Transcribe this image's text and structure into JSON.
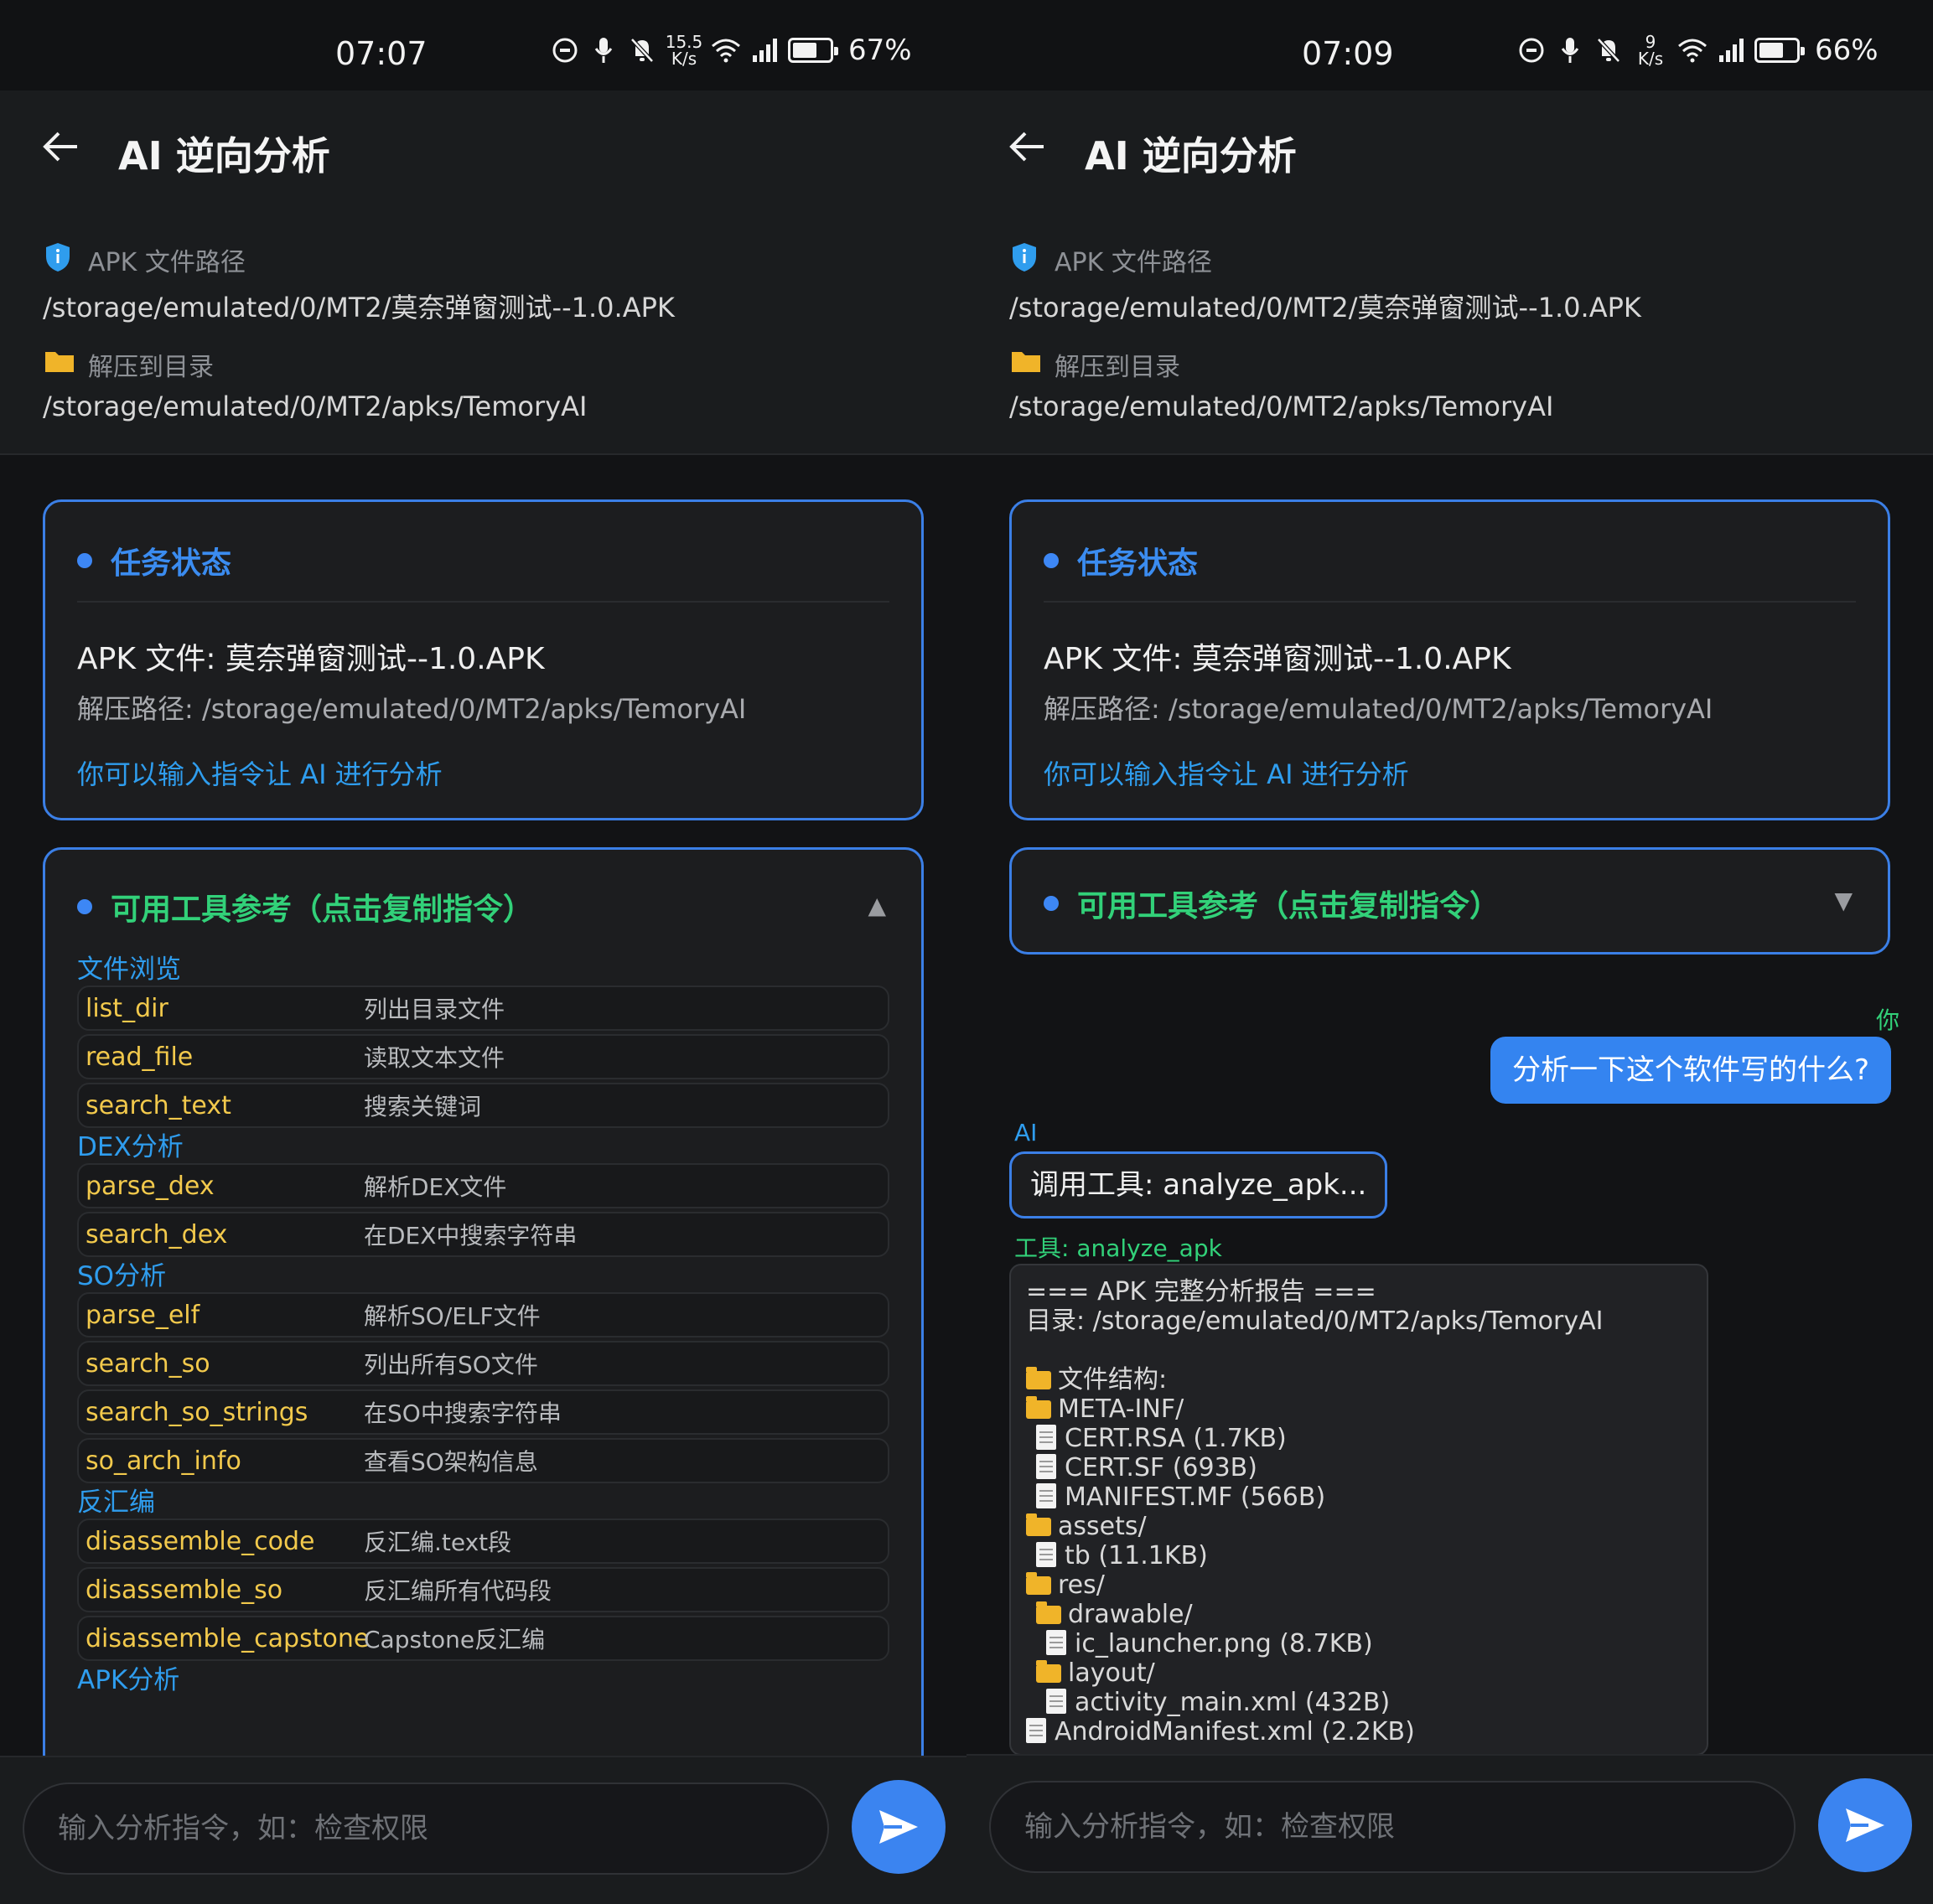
{
  "screens": [
    {
      "status": {
        "time": "07:07",
        "speed_top": "15.5",
        "speed_bottom": "K/s",
        "battery_pct": 0.67,
        "battery_text": "67%"
      },
      "header": {
        "title": "AI 逆向分析",
        "apk_label": "APK 文件路径",
        "apk_path": "/storage/emulated/0/MT2/莫奈弹窗测试--1.0.APK",
        "dir_label": "解压到目录",
        "dir_path": "/storage/emulated/0/MT2/apks/TemoryAI"
      },
      "task": {
        "title": "任务状态",
        "apk_file": "APK 文件: 莫奈弹窗测试--1.0.APK",
        "extract_path": "解压路径: /storage/emulated/0/MT2/apks/TemoryAI",
        "hint": "你可以输入指令让 AI 进行分析"
      },
      "tools": {
        "title": "可用工具参考（点击复制指令）",
        "caret": "▲"
      },
      "input": {
        "placeholder": "输入分析指令，如：检查权限"
      }
    },
    {
      "status": {
        "time": "07:09",
        "speed_top": "9",
        "speed_bottom": "K/s",
        "battery_pct": 0.66,
        "battery_text": "66%"
      },
      "header": {
        "title": "AI 逆向分析",
        "apk_label": "APK 文件路径",
        "apk_path": "/storage/emulated/0/MT2/莫奈弹窗测试--1.0.APK",
        "dir_label": "解压到目录",
        "dir_path": "/storage/emulated/0/MT2/apks/TemoryAI"
      },
      "task": {
        "title": "任务状态",
        "apk_file": "APK 文件: 莫奈弹窗测试--1.0.APK",
        "extract_path": "解压路径: /storage/emulated/0/MT2/apks/TemoryAI",
        "hint": "你可以输入指令让 AI 进行分析"
      },
      "tools": {
        "title": "可用工具参考（点击复制指令）",
        "caret": "▼"
      },
      "input": {
        "placeholder": "输入分析指令，如：检查权限"
      }
    }
  ],
  "tool_categories": [
    {
      "label": "文件浏览",
      "items": [
        {
          "name": "list_dir",
          "desc": "列出目录文件"
        },
        {
          "name": "read_file",
          "desc": "读取文本文件"
        },
        {
          "name": "search_text",
          "desc": "搜索关键词"
        }
      ]
    },
    {
      "label": "DEX分析",
      "items": [
        {
          "name": "parse_dex",
          "desc": "解析DEX文件"
        },
        {
          "name": "search_dex",
          "desc": "在DEX中搜索字符串"
        }
      ]
    },
    {
      "label": "SO分析",
      "items": [
        {
          "name": "parse_elf",
          "desc": "解析SO/ELF文件"
        },
        {
          "name": "search_so",
          "desc": "列出所有SO文件"
        },
        {
          "name": "search_so_strings",
          "desc": "在SO中搜索字符串"
        },
        {
          "name": "so_arch_info",
          "desc": "查看SO架构信息"
        }
      ]
    },
    {
      "label": "反汇编",
      "items": [
        {
          "name": "disassemble_code",
          "desc": "反汇编.text段"
        },
        {
          "name": "disassemble_so",
          "desc": "反汇编所有代码段"
        },
        {
          "name": "disassemble_capstone",
          "desc": "Capstone反汇编"
        }
      ]
    },
    {
      "label": "APK分析",
      "items": []
    }
  ],
  "chat": {
    "user_role": "你",
    "user_message": "分析一下这个软件写的什么?",
    "ai_role": "AI",
    "ai_message": "调用工具: analyze_apk...",
    "tool_label": "工具: analyze_apk",
    "tool_output": [
      {
        "icon": "",
        "indent": 0,
        "text": "=== APK 完整分析报告 ==="
      },
      {
        "icon": "",
        "indent": 0,
        "text": "目录: /storage/emulated/0/MT2/apks/TemoryAI"
      },
      {
        "icon": "",
        "indent": 0,
        "text": ""
      },
      {
        "icon": "folder",
        "indent": 0,
        "text": "文件结构:"
      },
      {
        "icon": "folder",
        "indent": 0,
        "text": "META-INF/"
      },
      {
        "icon": "file",
        "indent": 1,
        "text": "CERT.RSA (1.7KB)"
      },
      {
        "icon": "file",
        "indent": 1,
        "text": "CERT.SF (693B)"
      },
      {
        "icon": "file",
        "indent": 1,
        "text": "MANIFEST.MF (566B)"
      },
      {
        "icon": "folder",
        "indent": 0,
        "text": "assets/"
      },
      {
        "icon": "file",
        "indent": 1,
        "text": "tb (11.1KB)"
      },
      {
        "icon": "folder",
        "indent": 0,
        "text": "res/"
      },
      {
        "icon": "folder",
        "indent": 1,
        "text": "drawable/"
      },
      {
        "icon": "file",
        "indent": 2,
        "text": "ic_launcher.png (8.7KB)"
      },
      {
        "icon": "folder",
        "indent": 1,
        "text": "layout/"
      },
      {
        "icon": "file",
        "indent": 2,
        "text": "activity_main.xml (432B)"
      },
      {
        "icon": "file",
        "indent": 0,
        "text": "AndroidManifest.xml (2.2KB)"
      }
    ]
  },
  "colors": {
    "accent": "#3b84f0",
    "green": "#32d179",
    "yellow": "#f2c94c",
    "link": "#2f9dee"
  },
  "icons": [
    "back-arrow-icon",
    "shield-icon",
    "folder-icon",
    "send-icon",
    "dnd-icon",
    "mic-icon",
    "bell-off-icon",
    "wifi-icon",
    "signal-icon",
    "battery-icon"
  ]
}
